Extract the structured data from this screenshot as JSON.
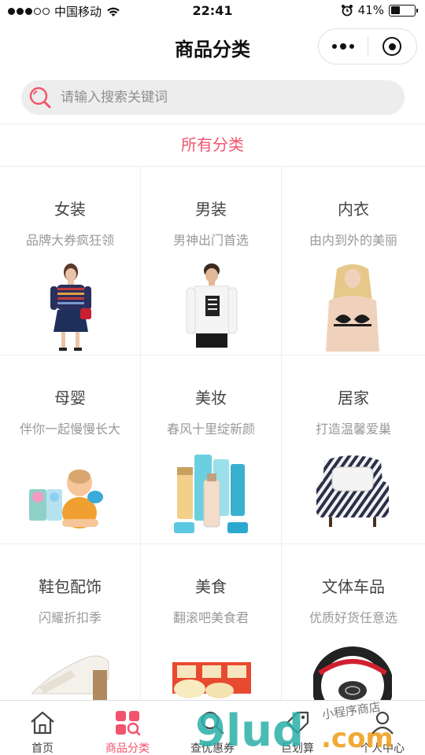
{
  "status_bar": {
    "carrier": "中国移动",
    "time": "22:41",
    "battery": "41%",
    "battery_level": 0.41
  },
  "nav": {
    "title": "商品分类"
  },
  "search": {
    "placeholder": "请输入搜索关键词"
  },
  "section": {
    "title": "所有分类"
  },
  "categories": [
    {
      "name": "女装",
      "desc": "品牌大券疯狂领",
      "image": "woman-model-striped-top"
    },
    {
      "name": "男装",
      "desc": "男神出门首选",
      "image": "man-model-white-sweatshirt"
    },
    {
      "name": "内衣",
      "desc": "由内到外的美丽",
      "image": "lingerie-model"
    },
    {
      "name": "母婴",
      "desc": "伴你一起慢慢长大",
      "image": "baby-with-toys"
    },
    {
      "name": "美妆",
      "desc": "春风十里绽新颜",
      "image": "cosmetics-bottles"
    },
    {
      "name": "居家",
      "desc": "打造温馨爱巢",
      "image": "zebra-armchair"
    },
    {
      "name": "鞋包配饰",
      "desc": "闪耀折扣季",
      "image": "white-sandal"
    },
    {
      "name": "美食",
      "desc": "翻滚吧美食君",
      "image": "snack-box"
    },
    {
      "name": "文体车品",
      "desc": "优质好货任意选",
      "image": "steering-wheel-cover"
    }
  ],
  "tabbar": [
    {
      "label": "首页",
      "icon": "home-icon",
      "active": false
    },
    {
      "label": "商品分类",
      "icon": "category-icon",
      "active": true
    },
    {
      "label": "查优惠券",
      "icon": "coupon-search-icon",
      "active": false
    },
    {
      "label": "巨划算",
      "icon": "deal-tag-icon",
      "active": false
    },
    {
      "label": "个人中心",
      "icon": "user-icon",
      "active": false
    }
  ],
  "watermark": {
    "text": "小程序商店",
    "logo": "9lud.com"
  },
  "colors": {
    "accent": "#f2546c",
    "divider": "#eeeeee",
    "search_bg": "#ededed"
  }
}
